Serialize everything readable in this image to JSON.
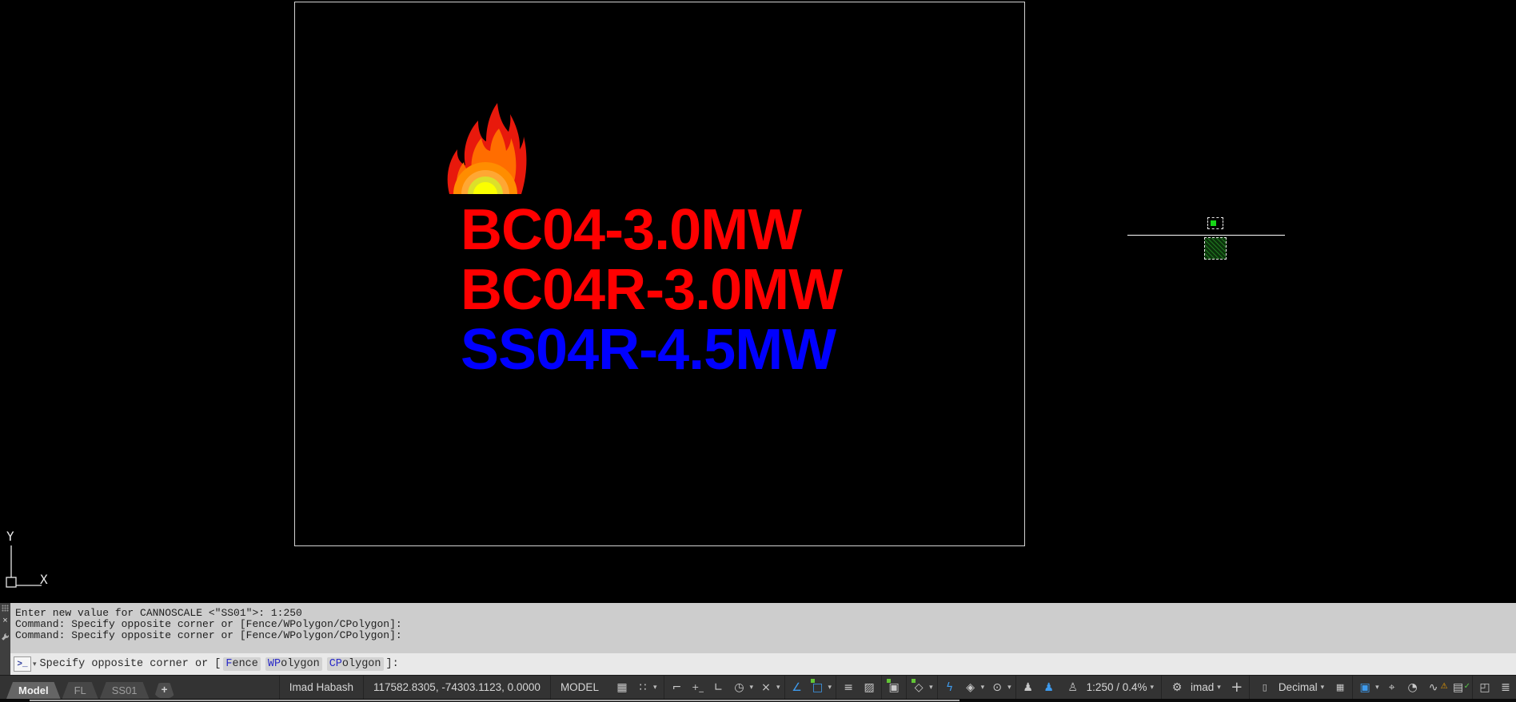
{
  "drawing": {
    "labels": [
      {
        "text": "BC04-3.0MW",
        "color": "#ff0000"
      },
      {
        "text": "BC04R-3.0MW",
        "color": "#ff0000"
      },
      {
        "text": "SS04R-4.5MW",
        "color": "#0000ff"
      }
    ],
    "ucs": {
      "x_label": "X",
      "y_label": "Y"
    }
  },
  "command": {
    "close_icon": "×",
    "history": [
      "Enter new value for CANNOSCALE <\"SS01\">: 1:250",
      "Command: Specify opposite corner or [Fence/WPolygon/CPolygon]:",
      "Command: Specify opposite corner or [Fence/WPolygon/CPolygon]:"
    ],
    "prompt": {
      "icon": ">_",
      "caret": "▾",
      "prefix": "Specify opposite corner or [",
      "options": [
        {
          "hot": "F",
          "rest": "ence"
        },
        {
          "hot": "WP",
          "rest": "olygon"
        },
        {
          "hot": "CP",
          "rest": "olygon"
        }
      ],
      "suffix": "]:"
    }
  },
  "layout_tabs": {
    "items": [
      {
        "label": "Model",
        "active": true
      },
      {
        "label": "FL",
        "active": false
      },
      {
        "label": "SS01",
        "active": false
      }
    ],
    "add_label": "+"
  },
  "status": {
    "user": "Imad Habash",
    "coordinates": "117582.8305, -74303.1123, 0.0000",
    "space": "MODEL",
    "annotation_scale": "1:250 / 0.4%",
    "workspace": "imad",
    "units": "Decimal",
    "caret": "▾",
    "icons": {
      "grid": "▦",
      "snap": "∷",
      "infer": "⌐",
      "dyninput": "+_",
      "ortho": "∟",
      "polar": "◷",
      "isodraft": "×",
      "otrack": "∠",
      "osnap": "□",
      "lineweight": "≡",
      "transparency": "▨",
      "cycling": "▣",
      "osnap3d": "◇",
      "ducs": "ϟ",
      "ucs_cube": "◈",
      "annot_monitor": "⊙",
      "annot_vis": "♟",
      "autoscale": "♟",
      "scale_person": "♙",
      "gear": "⚙",
      "plus": "+",
      "ruler": "▯",
      "quickcalc": "▦",
      "display_lock": "▣",
      "isolate": "⌖",
      "clock": "◔",
      "perf": "∿",
      "perf_warn": "⚠",
      "hw": "▤",
      "hw_check": "✓",
      "clean_screen": "◰",
      "customization": "≣"
    },
    "colors": {
      "accent_blue": "#3e9bee",
      "grip_green": "#17d517",
      "text_red": "#ff0000",
      "text_blue": "#0000ff"
    }
  }
}
